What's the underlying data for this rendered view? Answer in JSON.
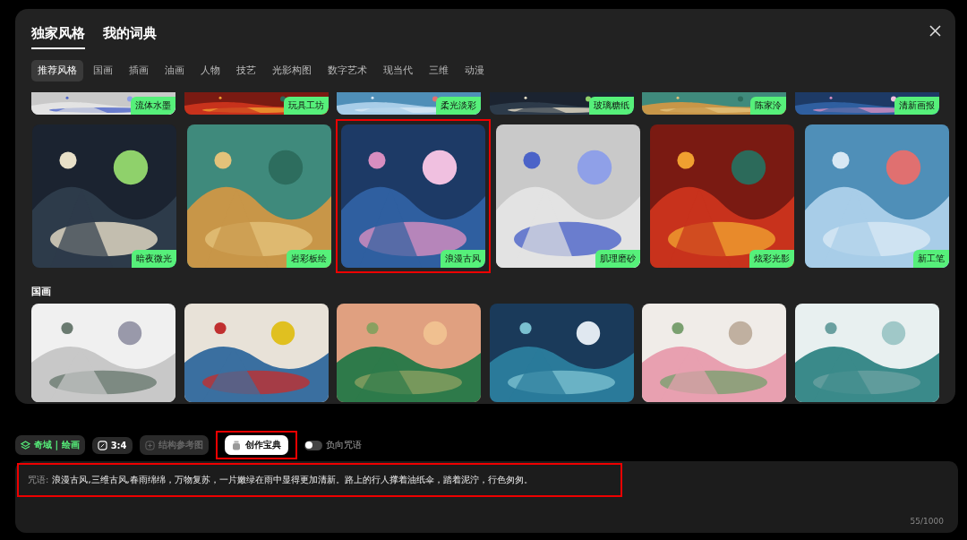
{
  "dialog": {
    "tabs": [
      {
        "label": "独家风格",
        "selected": true
      },
      {
        "label": "我的词典",
        "selected": false
      }
    ],
    "categories": [
      {
        "label": "推荐风格",
        "selected": true
      },
      {
        "label": "国画",
        "selected": false
      },
      {
        "label": "插画",
        "selected": false
      },
      {
        "label": "油画",
        "selected": false
      },
      {
        "label": "人物",
        "selected": false
      },
      {
        "label": "技艺",
        "selected": false
      },
      {
        "label": "光影构图",
        "selected": false
      },
      {
        "label": "数字艺术",
        "selected": false
      },
      {
        "label": "现当代",
        "selected": false
      },
      {
        "label": "三维",
        "selected": false
      },
      {
        "label": "动漫",
        "selected": false
      }
    ],
    "partial_row": [
      {
        "label": "流体水墨"
      },
      {
        "label": "玩具工坊"
      },
      {
        "label": "柔光淡彩"
      },
      {
        "label": "玻璃糖纸"
      },
      {
        "label": "陈家泠"
      },
      {
        "label": "清新画报"
      }
    ],
    "main_row": [
      {
        "label": "暗夜微光",
        "selected": false
      },
      {
        "label": "岩彩板绘",
        "selected": false
      },
      {
        "label": "浪漫古风",
        "selected": true
      },
      {
        "label": "肌理磨砂",
        "selected": false
      },
      {
        "label": "炫彩光影",
        "selected": false
      },
      {
        "label": "新工笔",
        "selected": false
      }
    ],
    "section_title": "国画"
  },
  "toolbar": {
    "model": {
      "name": "奇域",
      "separator": "|",
      "mode": "绘画"
    },
    "ratio": "3:4",
    "reference": {
      "label": "结构参考图",
      "disabled": true
    },
    "handbook": {
      "label": "创作宝典",
      "highlighted": true
    },
    "negative": {
      "label": "负向咒语",
      "on": false
    }
  },
  "prompt": {
    "label": "咒语:",
    "value": "浪漫古风,三维古风,春雨绵绵，万物复苏，一片嫩绿在雨中显得更加清新。路上的行人撑着油纸伞，踏着泥泞，行色匆匆。",
    "highlighted": true,
    "counter": "55/1000"
  }
}
